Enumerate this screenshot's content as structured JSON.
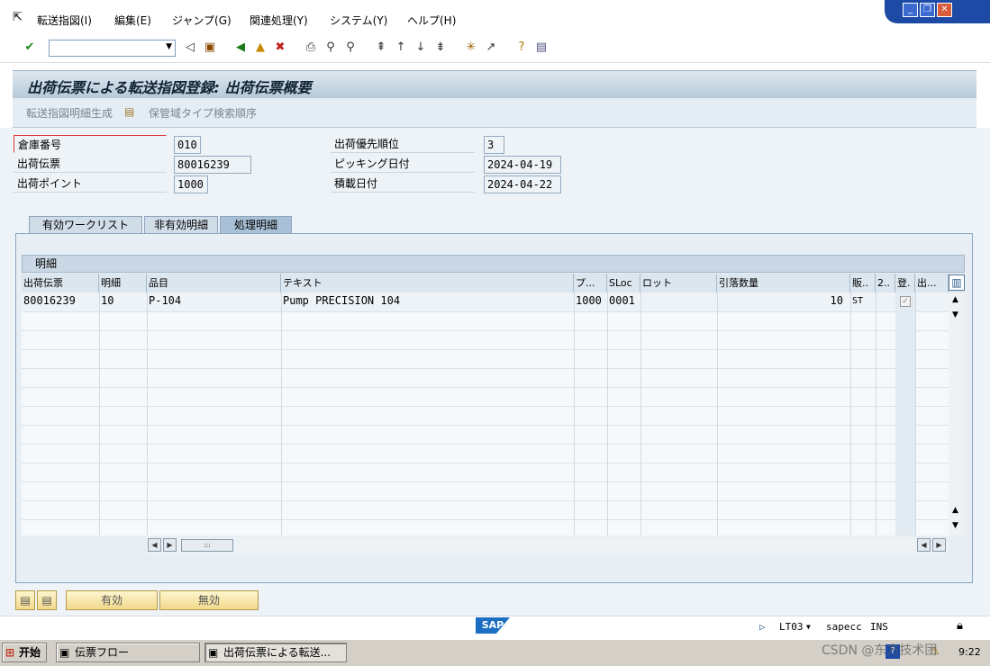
{
  "menu": [
    "転送指図(I)",
    "編集(E)",
    "ジャンプ(G)",
    "関連処理(Y)",
    "システム(Y)",
    "ヘルプ(H)"
  ],
  "title": "出荷伝票による転送指図登録: 出荷伝票概要",
  "app_toolbar": {
    "btn1": "転送指図明細生成",
    "btn2": "保管域タイプ検索順序"
  },
  "fields": {
    "warehouse_label": "倉庫番号",
    "warehouse_value": "010",
    "delivery_label": "出荷伝票",
    "delivery_value": "80016239",
    "shippoint_label": "出荷ポイント",
    "shippoint_value": "1000",
    "priority_label": "出荷優先順位",
    "priority_value": "3",
    "picking_label": "ピッキング日付",
    "picking_value": "2024-04-19",
    "loading_label": "積載日付",
    "loading_value": "2024-04-22"
  },
  "tabs": [
    "有効ワークリスト",
    "非有効明細",
    "処理明細"
  ],
  "grid": {
    "title": "明細",
    "headers": [
      "出荷伝票",
      "明細",
      "品目",
      "テキスト",
      "プ...",
      "SLoc",
      "ロット",
      "引落数量",
      "販..",
      "2..",
      "登.",
      "出..."
    ],
    "row": {
      "delivery": "80016239",
      "item": "10",
      "material": "P-104",
      "text": "Pump PRECISION 104",
      "plant": "1000",
      "sloc": "0001",
      "qty": "10",
      "unit": "ST"
    }
  },
  "bottom_buttons": {
    "valid": "有効",
    "invalid": "無効"
  },
  "status": {
    "sap": "SAP",
    "tcode": "LT03",
    "server": "sapecc",
    "mode": "INS"
  },
  "taskbar": {
    "start": "开始",
    "task1": "伝票フロー",
    "task2": "出荷伝票による転送...",
    "time": "9:22",
    "watermark": "CSDN @东方技术团"
  }
}
